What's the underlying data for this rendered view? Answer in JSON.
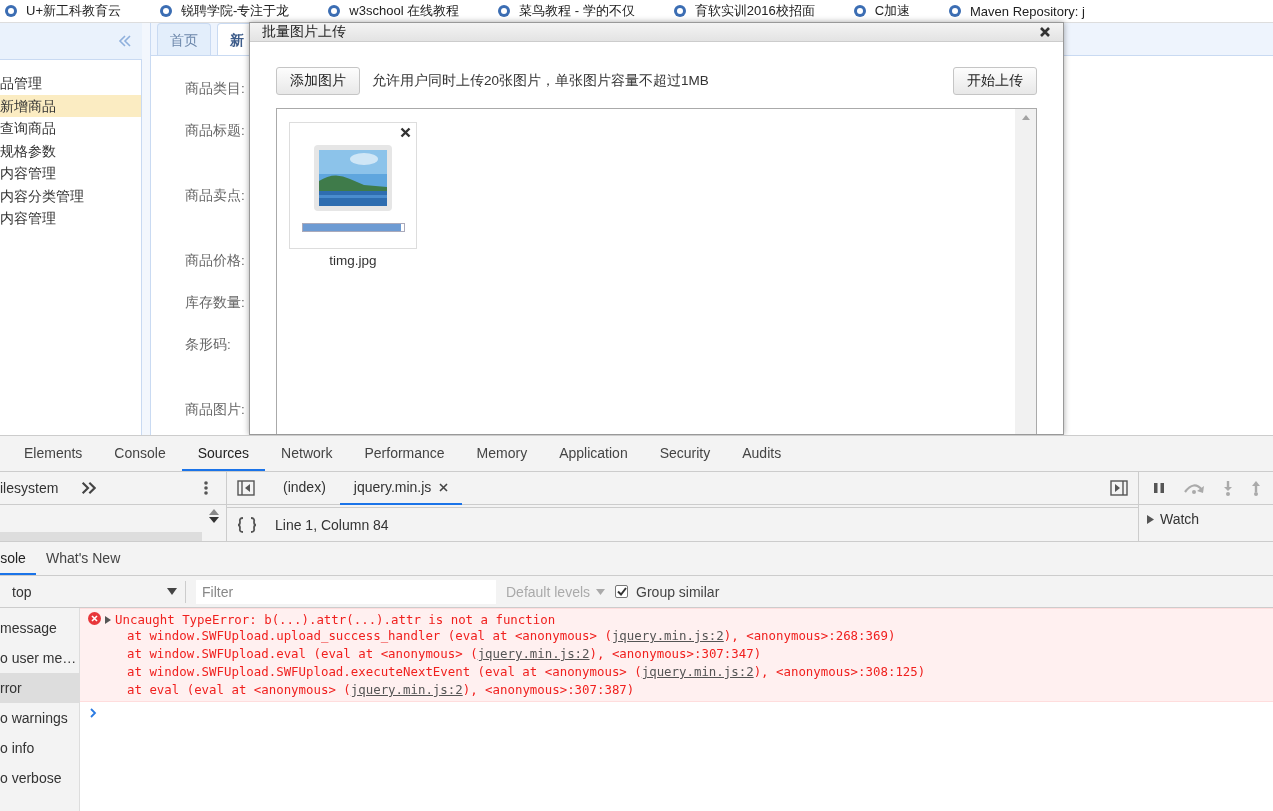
{
  "bookmarks": [
    {
      "label": "U+新工科教育云"
    },
    {
      "label": "锐聘学院-专注于龙"
    },
    {
      "label": "w3school 在线教程"
    },
    {
      "label": "菜鸟教程 - 学的不仅"
    },
    {
      "label": "育软实训2016校招面"
    },
    {
      "label": "C加速"
    },
    {
      "label": "Maven Repository: j"
    }
  ],
  "sidebar": {
    "items": [
      {
        "label": "品管理",
        "selected": false
      },
      {
        "label": "新增商品",
        "selected": true
      },
      {
        "label": "查询商品",
        "selected": false
      },
      {
        "label": "规格参数",
        "selected": false
      },
      {
        "label": "内容管理",
        "selected": false
      },
      {
        "label": "内容分类管理",
        "selected": false
      },
      {
        "label": "内容管理",
        "selected": false
      }
    ]
  },
  "page_tabs": [
    {
      "label": "首页",
      "selected": false
    },
    {
      "label": "新",
      "selected": true
    }
  ],
  "form_labels": [
    {
      "label": "商品类目:",
      "kind": "short"
    },
    {
      "label": "商品标题:",
      "kind": "tall"
    },
    {
      "label": "商品卖点:",
      "kind": "tall"
    },
    {
      "label": "商品价格:",
      "kind": "short"
    },
    {
      "label": "库存数量:",
      "kind": "short"
    },
    {
      "label": "条形码:",
      "kind": "tall"
    },
    {
      "label": "商品图片:",
      "kind": "short"
    }
  ],
  "dialog": {
    "title": "批量图片上传",
    "add_button": "添加图片",
    "hint": "允许用户同时上传20张图片，单张图片容量不超过1MB",
    "start_button": "开始上传",
    "files": [
      {
        "name": "timg.jpg",
        "level": 0.98
      }
    ]
  },
  "devtools": {
    "tabs": [
      {
        "label": "Elements",
        "selected": false
      },
      {
        "label": "Console",
        "selected": false
      },
      {
        "label": "Sources",
        "selected": true
      },
      {
        "label": "Network",
        "selected": false
      },
      {
        "label": "Performance",
        "selected": false
      },
      {
        "label": "Memory",
        "selected": false
      },
      {
        "label": "Application",
        "selected": false
      },
      {
        "label": "Security",
        "selected": false
      },
      {
        "label": "Audits",
        "selected": false
      }
    ],
    "navigator": "ilesystem",
    "editor_tabs": [
      {
        "label": "(index)",
        "selected": false,
        "closable": false
      },
      {
        "label": "jquery.min.js",
        "selected": true,
        "closable": true
      }
    ],
    "status": "Line 1, Column 84",
    "watch": "Watch",
    "drawer_tabs": [
      {
        "label": "sole",
        "selected": true
      },
      {
        "label": "What's New",
        "selected": false
      }
    ],
    "context": "top",
    "filter": {
      "placeholder": "Filter"
    },
    "levels": "Default levels",
    "group_similar": {
      "label": "Group similar",
      "checked": true
    },
    "console_sidebar": [
      {
        "label": "message",
        "selected": false
      },
      {
        "label": "o user me…",
        "selected": false
      },
      {
        "label": "rror",
        "selected": true
      },
      {
        "label": "o warnings",
        "selected": false
      },
      {
        "label": "o info",
        "selected": false
      },
      {
        "label": "o verbose",
        "selected": false
      }
    ],
    "messages": [
      {
        "kind": "error",
        "title": "Uncaught TypeError: b(...).attr(...).attr is not a function",
        "stack": [
          {
            "text": "at window.SWFUpload.upload_success_handler (eval at <anonymous> (",
            "link": "jquery.min.js:2",
            "after": "), <anonymous>:268:369)"
          },
          {
            "text": "at window.SWFUpload.eval (eval at <anonymous> (",
            "link": "jquery.min.js:2",
            "after": "), <anonymous>:307:347)"
          },
          {
            "text": "at window.SWFUpload.SWFUpload.executeNextEvent (eval at <anonymous> (",
            "link": "jquery.min.js:2",
            "after": "), <anonymous>:308:125)"
          },
          {
            "text": "at eval (eval at <anonymous> (",
            "link": "jquery.min.js:2",
            "after": "), <anonymous>:307:387)"
          }
        ]
      }
    ]
  }
}
